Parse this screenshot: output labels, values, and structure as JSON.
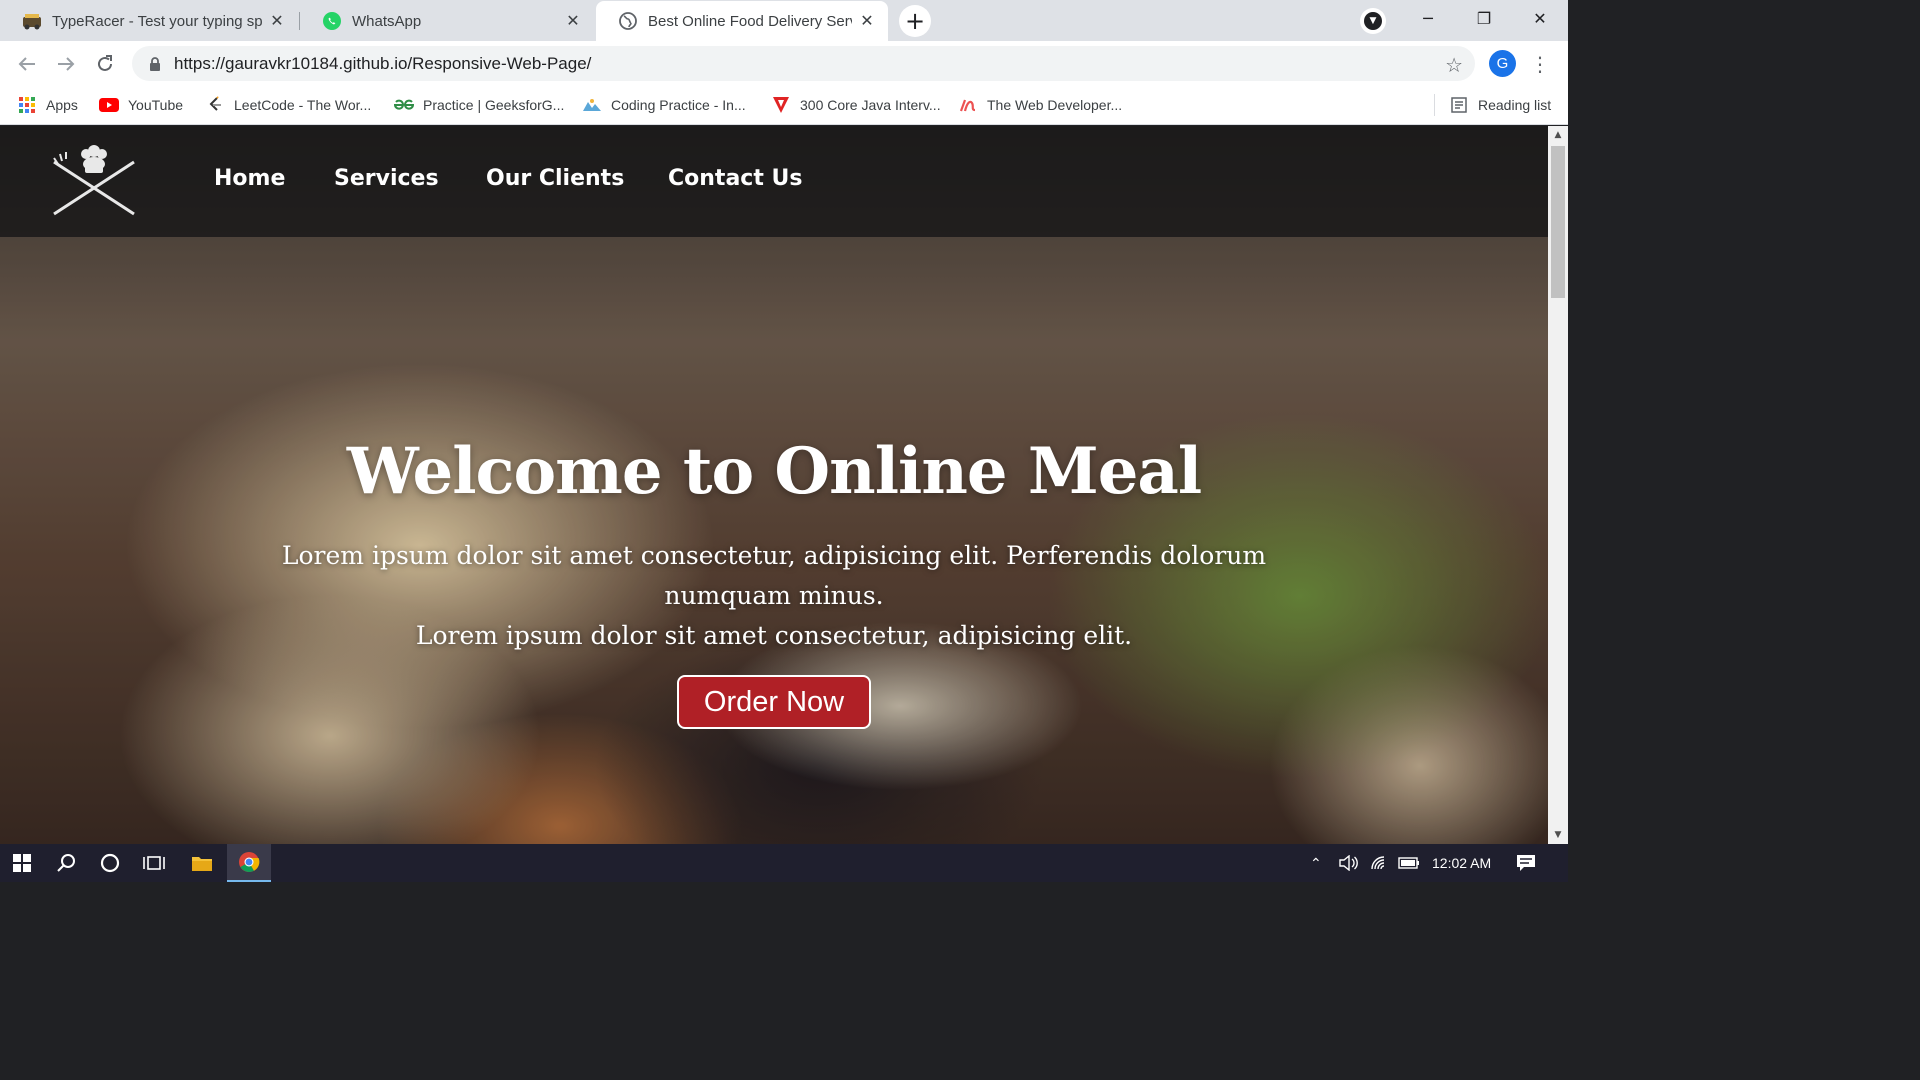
{
  "browser": {
    "tabs": [
      {
        "title": "TypeRacer - Test your typing spee",
        "icon": "typeracer-icon",
        "active": false
      },
      {
        "title": "WhatsApp",
        "icon": "whatsapp-icon",
        "active": false
      },
      {
        "title": "Best Online Food Delivery Service",
        "icon": "globe-icon",
        "active": true
      }
    ],
    "new_tab": "+",
    "url": "https://gauravkr10184.github.io/Responsive-Web-Page/",
    "profile_initial": "G",
    "bookmarks": [
      {
        "label": "Apps",
        "icon": "apps-grid-icon"
      },
      {
        "label": "YouTube",
        "icon": "youtube-icon"
      },
      {
        "label": "LeetCode - The Wor...",
        "icon": "leetcode-icon"
      },
      {
        "label": "Practice | GeeksforG...",
        "icon": "geeksforgeeks-icon"
      },
      {
        "label": "Coding Practice - In...",
        "icon": "coding-practice-icon"
      },
      {
        "label": "300 Core Java Interv...",
        "icon": "java-icon"
      },
      {
        "label": "The Web Developer...",
        "icon": "udemy-icon"
      }
    ],
    "reading_list": "Reading list"
  },
  "site": {
    "nav": [
      "Home",
      "Services",
      "Our Clients",
      "Contact Us"
    ],
    "hero": {
      "title": "Welcome to Online Meal",
      "line1": "Lorem ipsum dolor sit amet consectetur, adipisicing elit. Perferendis dolorum numquam minus.",
      "line2": "Lorem ipsum dolor sit amet consectetur, adipisicing elit.",
      "cta": "Order Now"
    },
    "colors": {
      "cta": "#b02026",
      "nav_bg": "#141416"
    }
  },
  "taskbar": {
    "time": "12:02 AM"
  }
}
